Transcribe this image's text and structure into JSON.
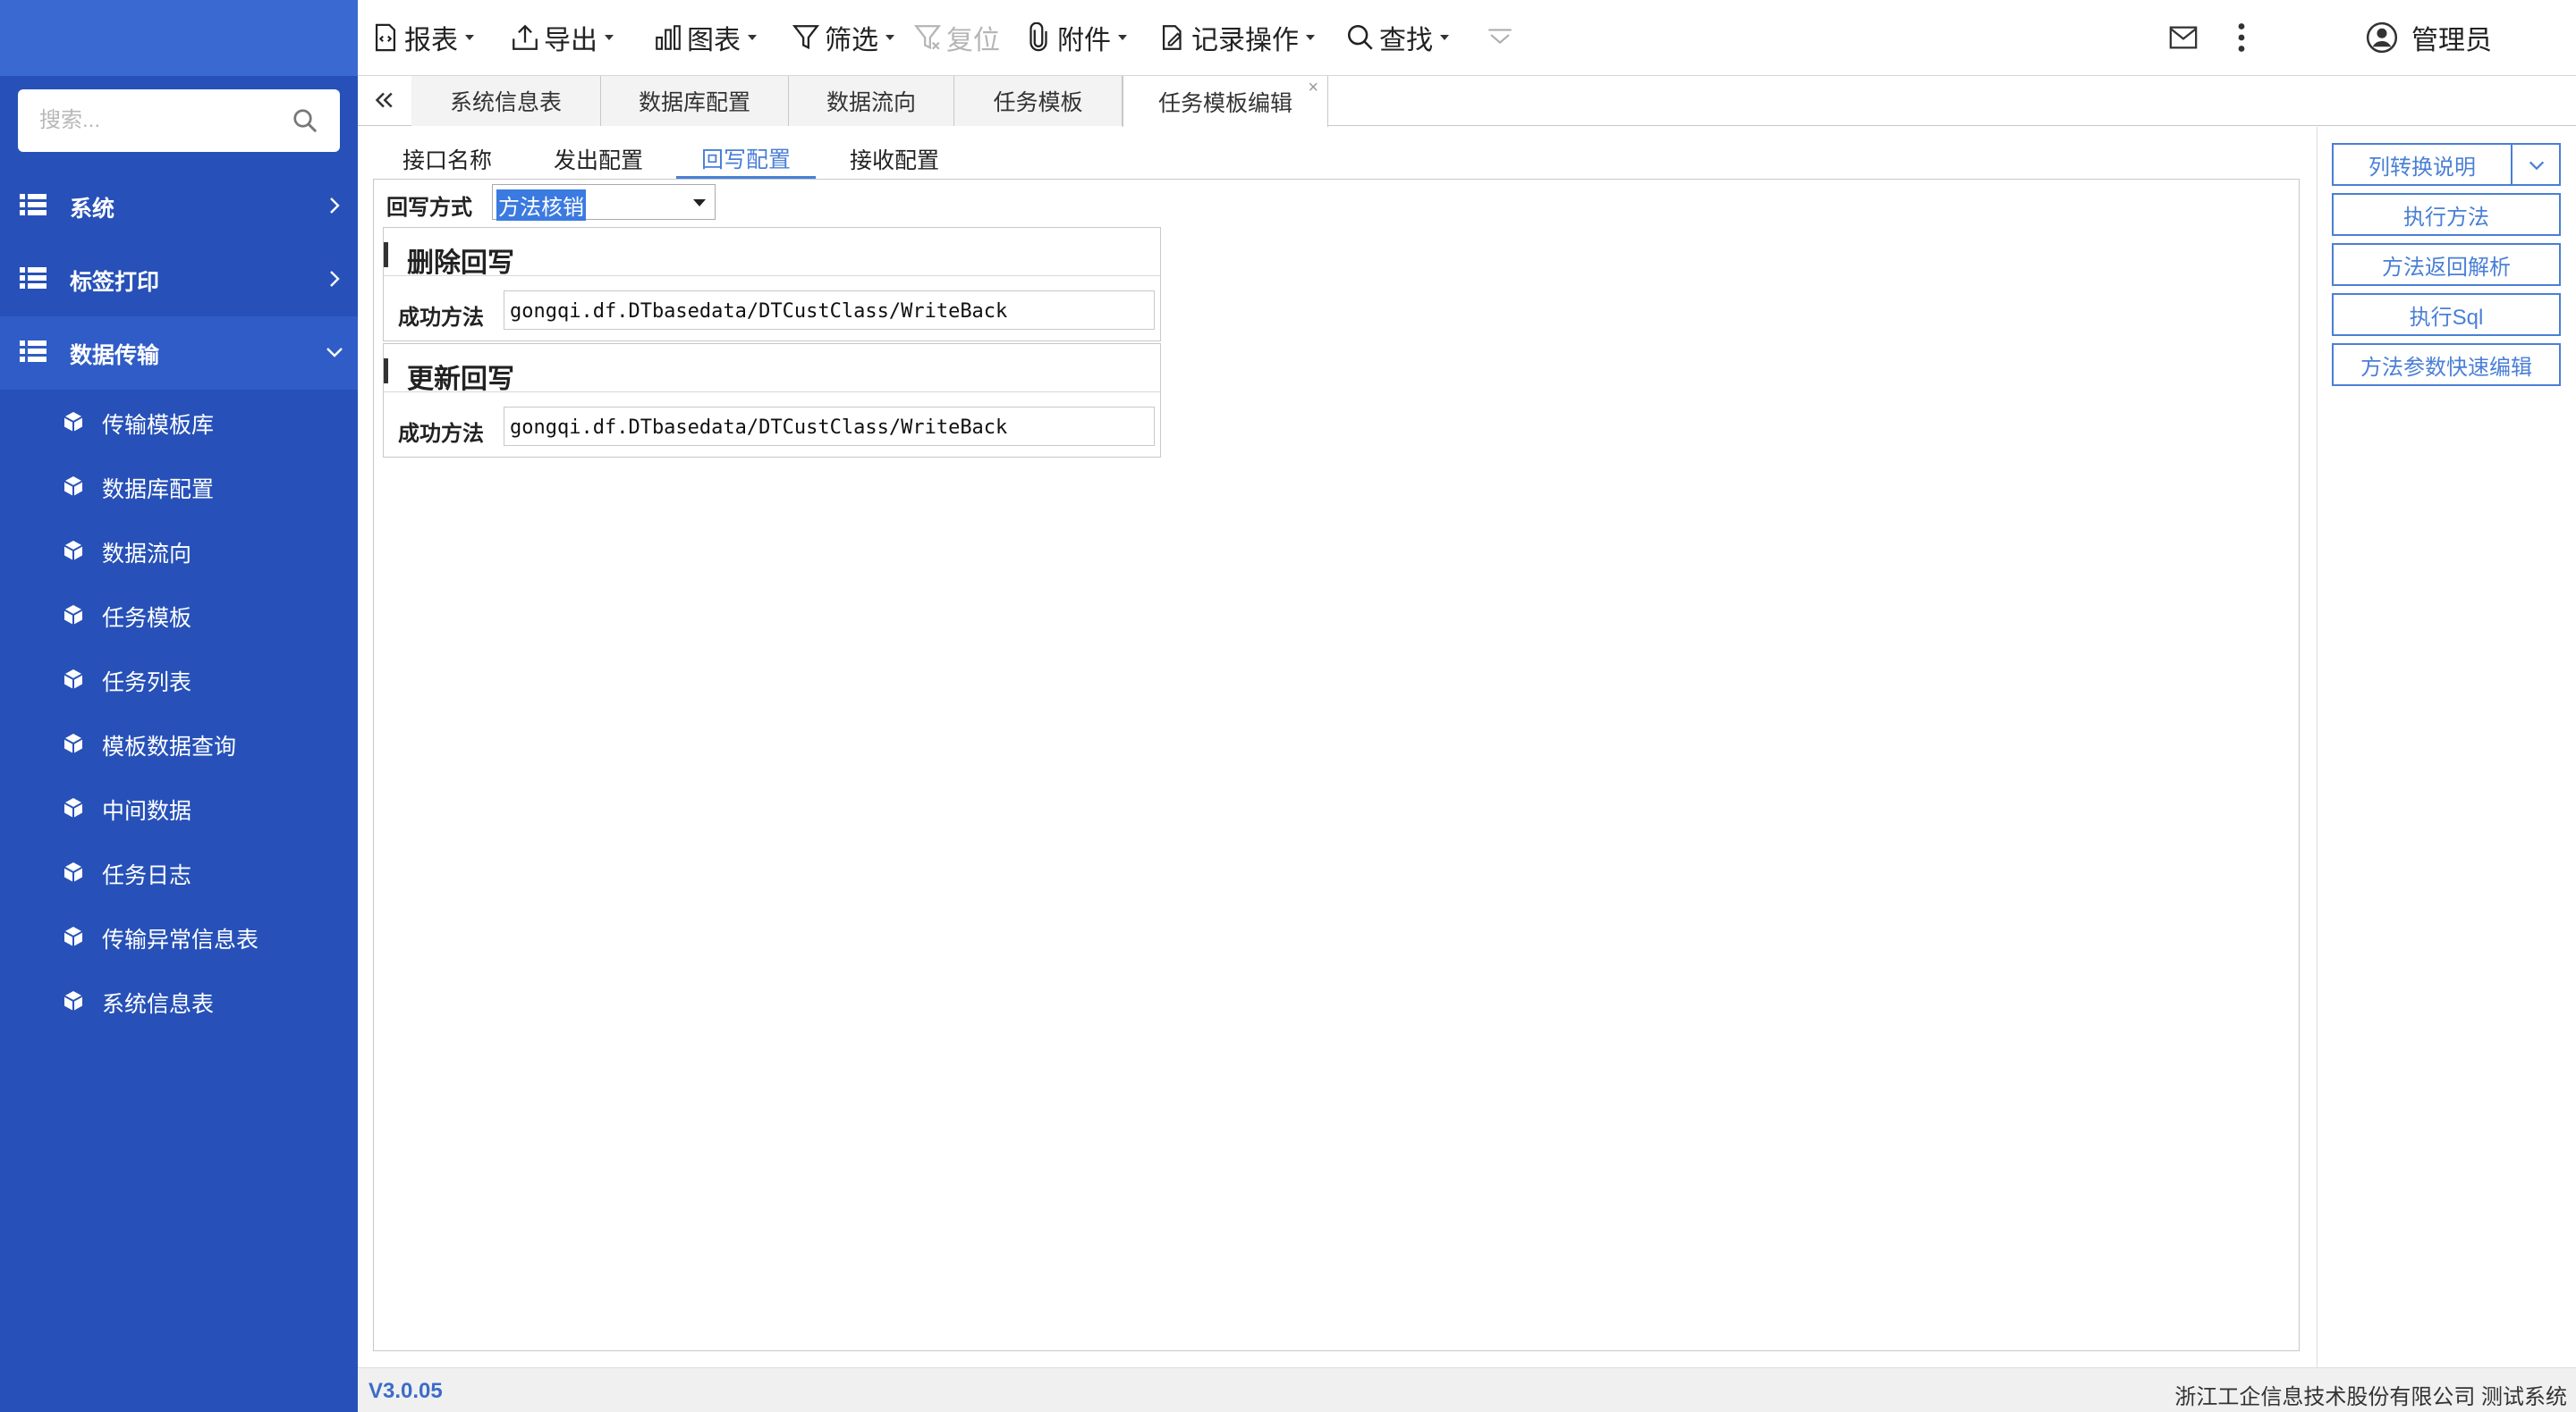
{
  "sidebar": {
    "search_placeholder": "搜索...",
    "groups": [
      {
        "label": "系统",
        "expanded": false
      },
      {
        "label": "标签打印",
        "expanded": false
      },
      {
        "label": "数据传输",
        "expanded": true
      }
    ],
    "items": [
      {
        "label": "传输模板库"
      },
      {
        "label": "数据库配置"
      },
      {
        "label": "数据流向"
      },
      {
        "label": "任务模板"
      },
      {
        "label": "任务列表"
      },
      {
        "label": "模板数据查询"
      },
      {
        "label": "中间数据"
      },
      {
        "label": "任务日志"
      },
      {
        "label": "传输异常信息表"
      },
      {
        "label": "系统信息表"
      }
    ]
  },
  "toolbar": {
    "report": "报表",
    "export": "导出",
    "chart": "图表",
    "filter": "筛选",
    "reset": "复位",
    "attachment": "附件",
    "record_ops": "记录操作",
    "find": "查找",
    "user": "管理员"
  },
  "tabs": [
    {
      "label": "系统信息表"
    },
    {
      "label": "数据库配置"
    },
    {
      "label": "数据流向"
    },
    {
      "label": "任务模板"
    },
    {
      "label": "任务模板编辑",
      "active": true,
      "close": "×"
    }
  ],
  "subtabs": [
    {
      "label": "接口名称"
    },
    {
      "label": "发出配置"
    },
    {
      "label": "回写配置",
      "active": true
    },
    {
      "label": "接收配置"
    }
  ],
  "form": {
    "writeback_mode_label": "回写方式",
    "writeback_mode_value": "方法核销",
    "sections": [
      {
        "title": "删除回写",
        "label": "成功方法",
        "value": "gongqi.df.DTbasedata/DTCustClass/WriteBack"
      },
      {
        "title": "更新回写",
        "label": "成功方法",
        "value": "gongqi.df.DTbasedata/DTCustClass/WriteBack"
      }
    ]
  },
  "actions": {
    "column_convert": "列转换说明",
    "execute_method": "执行方法",
    "parse_return": "方法返回解析",
    "execute_sql": "执行Sql",
    "quick_edit": "方法参数快速编辑"
  },
  "footer": {
    "version": "V3.0.05",
    "company": "浙江工企信息技术股份有限公司 测试系统"
  },
  "colors": {
    "sidebar_bg": "#2751b8",
    "accent": "#4a7fd6",
    "selection": "#3b7ae0"
  }
}
